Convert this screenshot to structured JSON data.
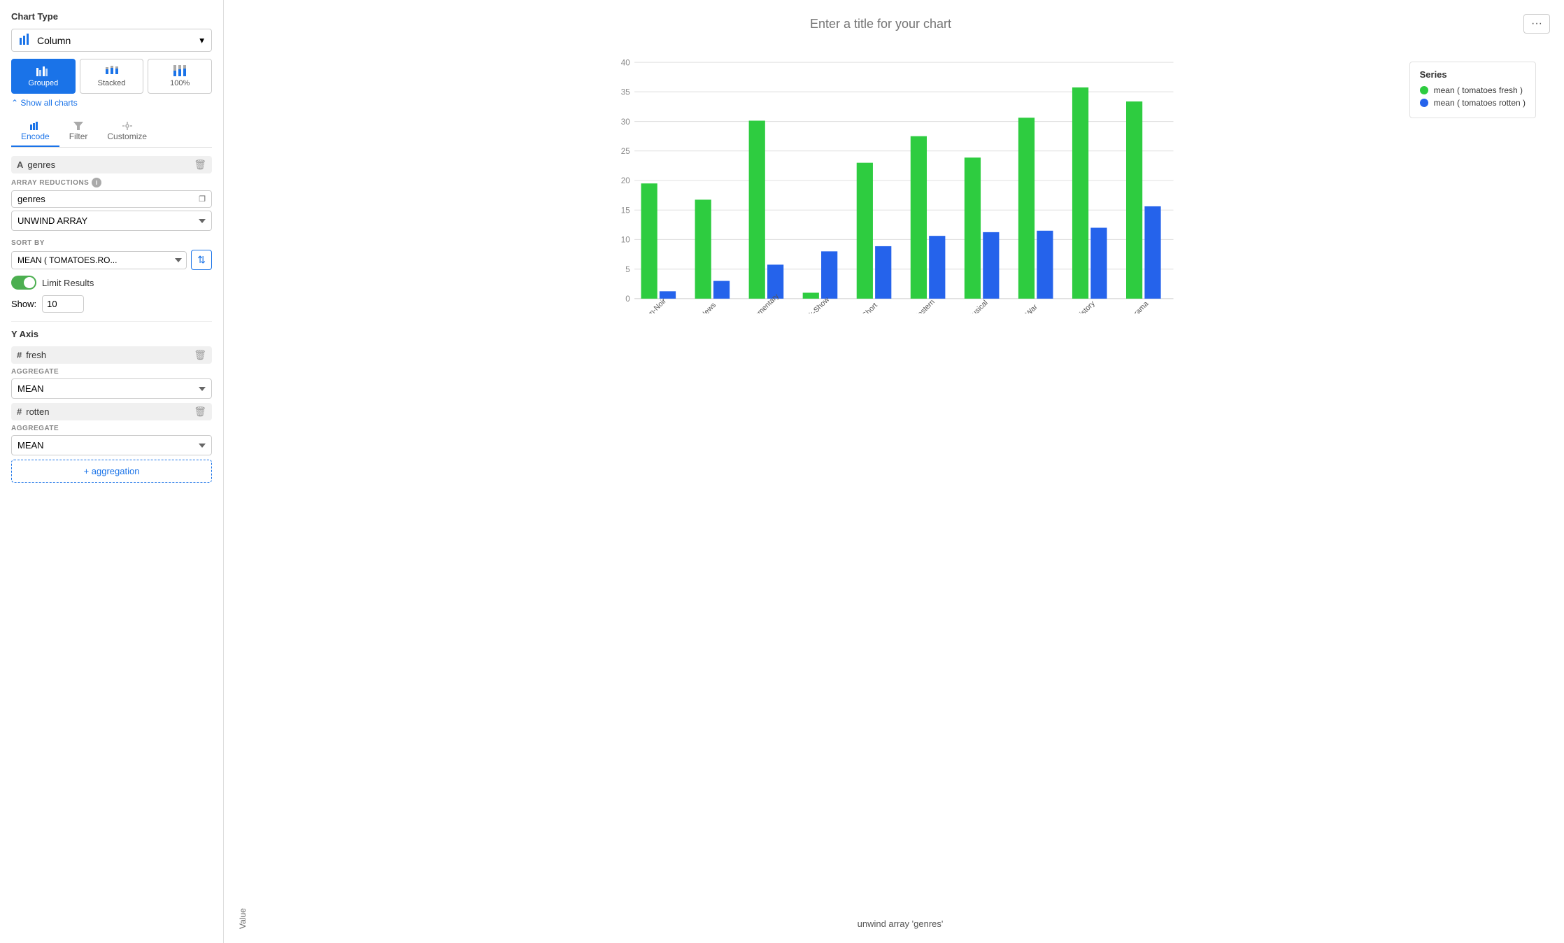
{
  "left_panel": {
    "chart_type_section": {
      "title": "Chart Type",
      "selected": "Column",
      "variants": [
        {
          "label": "Grouped",
          "active": true
        },
        {
          "label": "Stacked",
          "active": false
        },
        {
          "label": "100%",
          "active": false
        }
      ],
      "show_all": "Show all charts"
    },
    "tabs": [
      {
        "label": "Encode",
        "active": true
      },
      {
        "label": "Filter",
        "active": false
      },
      {
        "label": "Customize",
        "active": false
      }
    ],
    "x_axis": {
      "field_name": "genres",
      "array_reductions_label": "ARRAY REDUCTIONS",
      "array_field": "genres",
      "unwind_label": "UNWIND ARRAY",
      "sort_by_label": "SORT BY",
      "sort_value": "MEAN ( TOMATOES.RO...",
      "limit_label": "Limit Results",
      "show_label": "Show:",
      "show_value": "10"
    },
    "y_axis": {
      "title": "Y Axis",
      "fields": [
        {
          "name": "fresh",
          "aggregate_label": "AGGREGATE",
          "aggregate_value": "MEAN"
        },
        {
          "name": "rotten",
          "aggregate_label": "AGGREGATE",
          "aggregate_value": "MEAN"
        }
      ],
      "add_label": "+ aggregation"
    }
  },
  "chart": {
    "title_placeholder": "Enter a title for your chart",
    "more_button": "···",
    "y_axis_label": "Value",
    "x_axis_label": "unwind array 'genres'",
    "y_max": 40,
    "y_ticks": [
      0,
      5,
      10,
      15,
      20,
      25,
      30,
      35,
      40
    ],
    "categories": [
      "Film-Noir",
      "News",
      "Documentary",
      "Talk-Show",
      "Short",
      "Western",
      "Musical",
      "War",
      "History",
      "Drama"
    ],
    "series": [
      {
        "name": "mean ( tomatoes fresh )",
        "color": "#2ecc40",
        "data": [
          19.5,
          16.8,
          30.1,
          1.0,
          23.0,
          27.5,
          23.9,
          30.7,
          35.7,
          33.4
        ]
      },
      {
        "name": "mean ( tomatoes rotten )",
        "color": "#2563eb",
        "data": [
          1.3,
          3.0,
          5.7,
          8.0,
          8.9,
          10.6,
          11.2,
          11.5,
          12.0,
          15.6
        ]
      }
    ],
    "legend_title": "Series"
  }
}
